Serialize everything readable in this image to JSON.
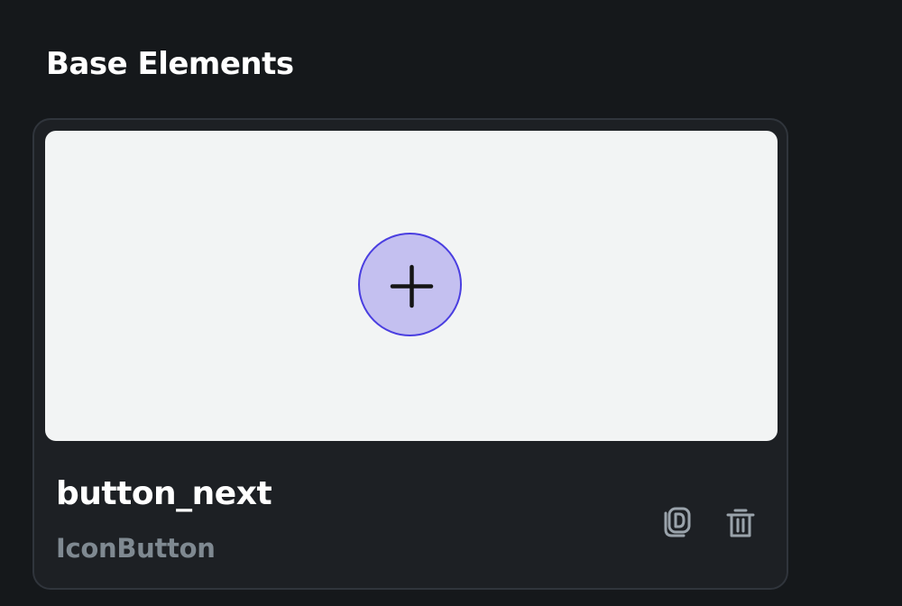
{
  "section": {
    "title": "Base Elements"
  },
  "card": {
    "name": "button_next",
    "type": "IconButton",
    "preview": {
      "icon": "plus-icon"
    },
    "actions": [
      {
        "icon": "duplicate-icon"
      },
      {
        "icon": "trash-icon"
      }
    ]
  },
  "colors": {
    "page_background": "#15181b",
    "card_background": "#1d2024",
    "card_border": "#30353c",
    "preview_background": "#f2f4f4",
    "icon_button_fill": "#c4c0f0",
    "icon_button_border": "#4a3ee0",
    "muted_text": "#7f8991",
    "action_icon": "#9aa3ab"
  }
}
